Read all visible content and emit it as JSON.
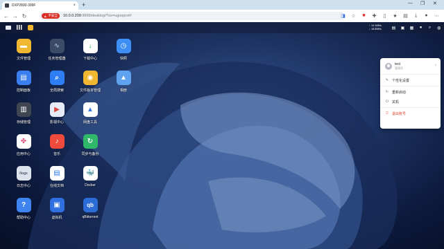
{
  "browser": {
    "tab_title": "DXP2800-399F",
    "close_glyph": "×",
    "new_tab_glyph": "+",
    "insecure_label": "不安全",
    "url_host": "10.0.0.209",
    "url_rest": ":9999/desktop/?os=ugospro#/",
    "window_controls": [
      "—",
      "❐",
      "✕"
    ]
  },
  "topbar": {
    "speed_up": "↑ 14.16B/s",
    "speed_down": "↓ 18.86B/s"
  },
  "apps": [
    {
      "label": "文件管理",
      "color": "#f2b730",
      "icon": "folder-icon"
    },
    {
      "label": "任务管理器",
      "color": "#3b4a66",
      "icon": "chart-icon"
    },
    {
      "label": "下载中心",
      "color": "#ffffff",
      "icon": "download-icon"
    },
    {
      "label": "快照",
      "color": "#3d8ff5",
      "icon": "clock-icon"
    },
    {
      "label": "控制面板",
      "color": "#3a7ef0",
      "icon": "panel-icon"
    },
    {
      "label": "全局搜索",
      "color": "#2f7df3",
      "icon": "search-icon"
    },
    {
      "label": "文件版本管理",
      "color": "#f2b730",
      "icon": "camera-icon"
    },
    {
      "label": "相册",
      "color": "#5fa3f0",
      "icon": "photo-icon"
    },
    {
      "label": "存储管理",
      "color": "#404552",
      "icon": "storage-icon"
    },
    {
      "label": "影视中心",
      "color": "#e5ecf6",
      "icon": "film-icon"
    },
    {
      "label": "网盘工具",
      "color": "#ffffff",
      "icon": "cloud-drive-icon"
    },
    {
      "label": "",
      "color": "transparent",
      "icon": ""
    },
    {
      "label": "应用中心",
      "color": "#ffffff",
      "icon": "appstore-icon"
    },
    {
      "label": "音乐",
      "color": "#f04a3c",
      "icon": "music-icon"
    },
    {
      "label": "同步与备份",
      "color": "#2fb86a",
      "icon": "sync-icon"
    },
    {
      "label": "",
      "color": "transparent",
      "icon": ""
    },
    {
      "label": "日志中心",
      "color": "#dde3ec",
      "icon": "logs-icon"
    },
    {
      "label": "在线文档",
      "color": "#ffffff",
      "icon": "document-icon"
    },
    {
      "label": "Docker",
      "color": "#ffffff",
      "icon": "docker-icon"
    },
    {
      "label": "",
      "color": "transparent",
      "icon": ""
    },
    {
      "label": "帮助中心",
      "color": "#3e84f0",
      "icon": "help-icon"
    },
    {
      "label": "虚拟机",
      "color": "#2f6fe0",
      "icon": "vm-icon"
    },
    {
      "label": "qBittorrent",
      "color": "#2b6cd6",
      "icon": "qbittorrent-icon"
    }
  ],
  "user_menu": {
    "username": "test",
    "role": "管理员",
    "items": [
      {
        "label": "个性化设置",
        "icon": "brush-icon"
      },
      {
        "label": "重新启动",
        "icon": "restart-icon"
      },
      {
        "label": "关机",
        "icon": "power-icon"
      },
      {
        "label": "退出账号",
        "icon": "logout-icon"
      }
    ]
  },
  "glyphs": {
    "folder": "▬",
    "chart": "∿",
    "download": "↓",
    "clock": "◷",
    "panel": "▤",
    "search": "⌕",
    "camera": "◉",
    "photo": "▲",
    "storage": "▥",
    "film": "▶",
    "clouddrive": "▲",
    "appstore": "✤",
    "music": "♪",
    "sync": "↻",
    "logs": "/logs",
    "document": "▤",
    "docker": "🐳",
    "help": "?",
    "vm": "▣",
    "qb": "qb"
  }
}
